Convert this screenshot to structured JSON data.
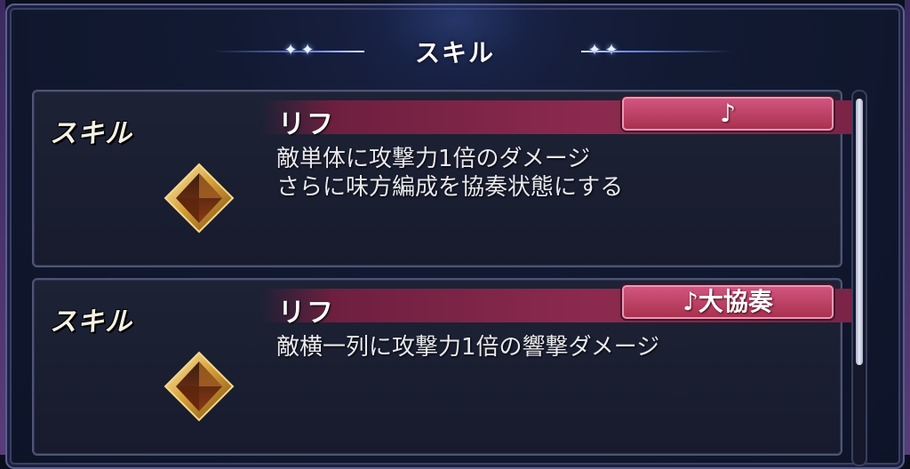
{
  "header": {
    "title": "スキル"
  },
  "skills": [
    {
      "label": "スキル",
      "icon": "gold-diamond-gem-icon",
      "name": "リフ",
      "tag": "♪",
      "description": [
        "敵単体に攻撃力1倍のダメージ",
        "さらに味方編成を協奏状態にする"
      ]
    },
    {
      "label": "スキル",
      "icon": "gold-diamond-gem-icon",
      "name": "リフ",
      "tag": "♪大協奏",
      "description": [
        "敵横一列に攻撃力1倍の響撃ダメージ"
      ]
    }
  ],
  "colors": {
    "accent_tag": "#c0436a",
    "name_bar": "#8c2a4e",
    "panel_bg": "#1b2033",
    "background": "#0e1428"
  }
}
